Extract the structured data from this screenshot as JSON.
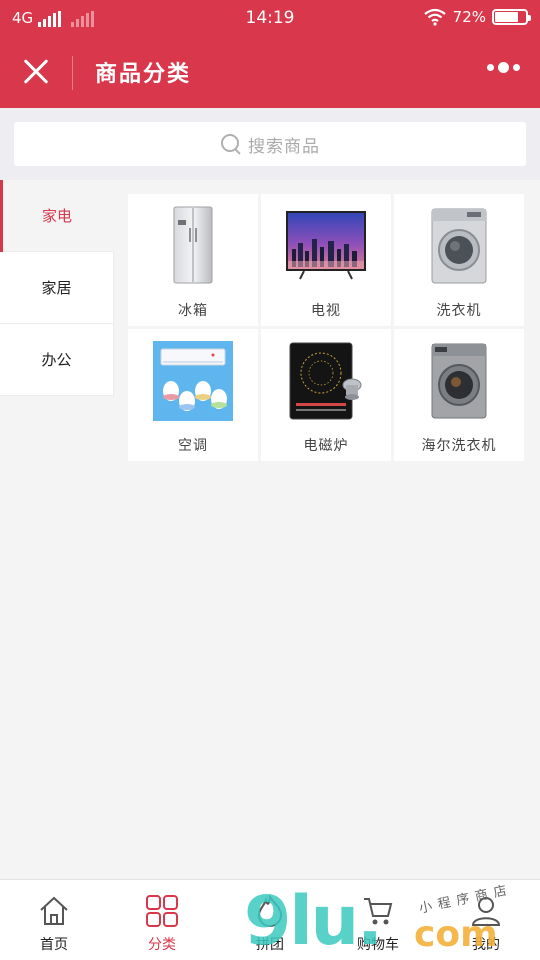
{
  "status_bar": {
    "network": "4G",
    "time": "14:19",
    "battery": "72%"
  },
  "navbar": {
    "title": "商品分类"
  },
  "search": {
    "placeholder": "搜索商品"
  },
  "categories": [
    {
      "label": "家电",
      "active": true
    },
    {
      "label": "家居",
      "active": false
    },
    {
      "label": "办公",
      "active": false
    }
  ],
  "products": [
    {
      "name": "冰箱",
      "icon": "refrigerator-icon"
    },
    {
      "name": "电视",
      "icon": "television-icon"
    },
    {
      "name": "洗衣机",
      "icon": "washing-machine-icon"
    },
    {
      "name": "空调",
      "icon": "air-conditioner-icon"
    },
    {
      "name": "电磁炉",
      "icon": "induction-cooker-icon"
    },
    {
      "name": "海尔洗衣机",
      "icon": "washing-machine-icon"
    }
  ],
  "tabbar": {
    "items": [
      {
        "label": "首页",
        "icon": "home-icon",
        "active": false
      },
      {
        "label": "分类",
        "icon": "grid-icon",
        "active": true
      },
      {
        "label": "拼团",
        "icon": "hot-icon",
        "active": false
      },
      {
        "label": "购物车",
        "icon": "cart-icon",
        "active": false
      },
      {
        "label": "我的",
        "icon": "user-icon",
        "active": false
      }
    ]
  },
  "watermark": {
    "brand": "9lu.",
    "domain": "com",
    "tagline": "小程序商店"
  },
  "colors": {
    "brand": "#d9374b",
    "background": "#f4f4f5"
  }
}
